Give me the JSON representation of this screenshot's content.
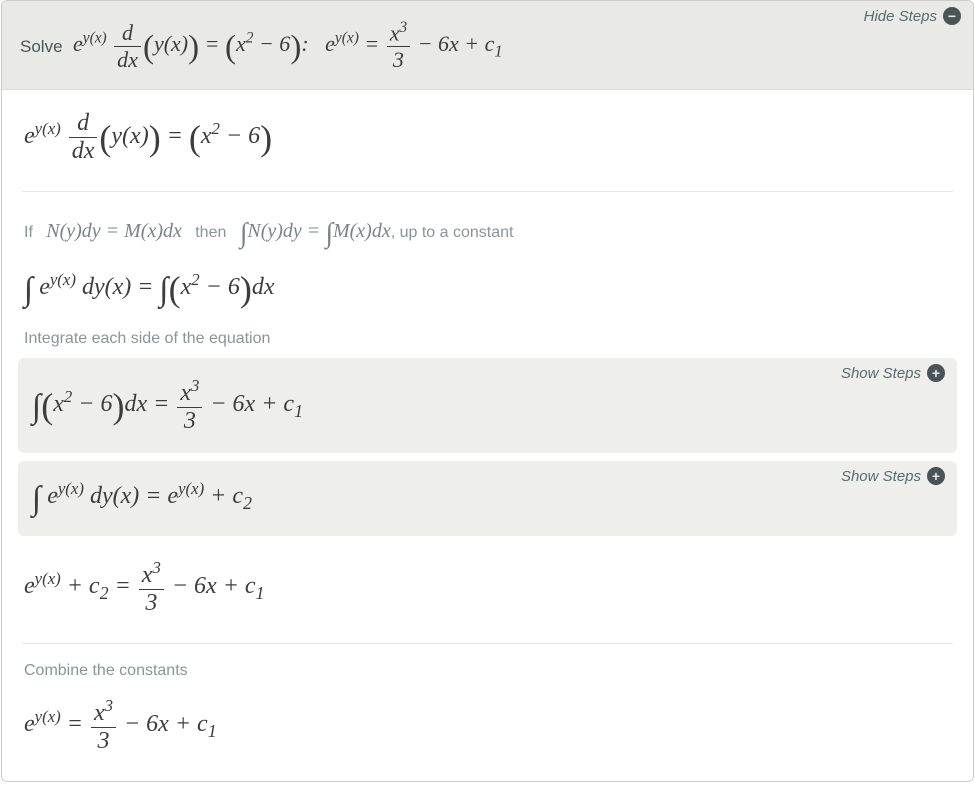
{
  "header": {
    "hide_steps_label": "Hide Steps",
    "solve_label": "Solve",
    "equation_html": "<span class='math'><i>e</i><sup>y(x)</sup> <span class='frac'><span class='num'>d</span><span class='den'>dx</span></span><span class='big'>(</span>y(x)<span class='big'>)</span> = <span class='big'>(</span>x<sup>2</sup> − 6<span class='big'>)</span>:&nbsp;&nbsp; e<sup>y(x)</sup> = <span class='frac'><span class='num'>x<sup>3</sup></span><span class='den'>3</span></span> − 6x + c<sub>1</sub></span>"
  },
  "steps": {
    "restate_html": "<span class='math eq'>e<sup>y(x)</sup> <span class='frac'><span class='num'>d</span><span class='den'>dx</span></span><span class='big'>(</span>y(x)<span class='big'>)</span> = <span class='big'>(</span>x<sup>2</sup> − 6<span class='big'>)</span></span>",
    "rule_prefix": "If",
    "rule_mid": "then",
    "rule_suffix": ", up to a constant",
    "rule_left_html": "<span class='math'>N(y)dy = M(x)dx</span>",
    "rule_right_html": "<span class='math'><span class='int'>∫</span>N(y)dy = <span class='int'>∫</span>M(x)dx</span>",
    "integral_setup_html": "<span class='math eq'><span class='int'>∫</span> e<sup>y(x)</sup> dy(x) = <span class='int'>∫</span><span class='big'>(</span>x<sup>2</sup> − 6<span class='big'>)</span>dx</span>",
    "integrate_label": "Integrate each side of the equation",
    "sub1_html": "<span class='math eq'><span class='int'>∫</span><span class='big'>(</span>x<sup>2</sup> − 6<span class='big'>)</span>dx = <span class='frac'><span class='num'>x<sup>3</sup></span><span class='den'>3</span></span> − 6x + c<sub>1</sub></span>",
    "sub2_html": "<span class='math eq'><span class='int'>∫</span> e<sup>y(x)</sup> dy(x) = e<sup>y(x)</sup> + c<sub>2</sub></span>",
    "show_steps_label": "Show Steps",
    "combined_html": "<span class='math eq'>e<sup>y(x)</sup> + c<sub>2</sub> = <span class='frac'><span class='num'>x<sup>3</sup></span><span class='den'>3</span></span> − 6x + c<sub>1</sub></span>",
    "combine_label": "Combine the constants",
    "final_html": "<span class='math eq'>e<sup>y(x)</sup> = <span class='frac'><span class='num'>x<sup>3</sup></span><span class='den'>3</span></span> − 6x + c<sub>1</sub></span>"
  }
}
